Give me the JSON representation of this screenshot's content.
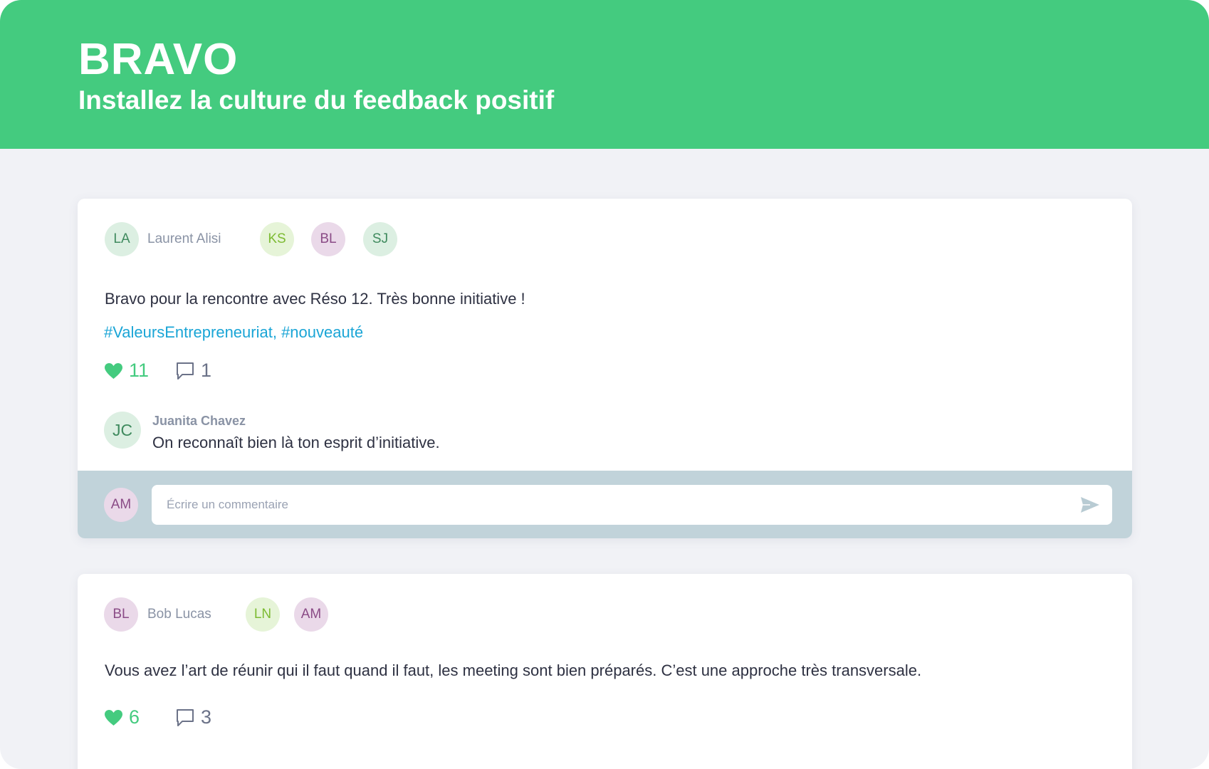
{
  "header": {
    "title": "BRAVO",
    "subtitle": "Installez la culture du feedback positif",
    "color": "#44cb7f"
  },
  "posts": [
    {
      "author": {
        "initials": "LA",
        "name": "Laurent Alisi"
      },
      "recipients": [
        {
          "initials": "KS"
        },
        {
          "initials": "BL"
        },
        {
          "initials": "SJ"
        }
      ],
      "message": "Bravo pour la rencontre avec Réso 12. Très bonne initiative !",
      "hashtags": "#ValeursEntrepreneuriat, #nouveauté",
      "likes": "11",
      "comments_count": "1",
      "comments": [
        {
          "initials": "JC",
          "author": "Juanita Chavez",
          "text": "On reconnaît bien là ton esprit d’initiative."
        }
      ],
      "composer": {
        "initials": "AM",
        "placeholder": "Écrire un commentaire",
        "send_icon": "send-icon"
      }
    },
    {
      "author": {
        "initials": "BL",
        "name": "Bob Lucas"
      },
      "recipients": [
        {
          "initials": "LN"
        },
        {
          "initials": "AM"
        }
      ],
      "message": "Vous avez l’art de réunir qui il faut quand il faut, les meeting sont bien préparés. C’est une approche très transversale.",
      "likes": "6",
      "comments_count": "3"
    }
  ],
  "icons": {
    "like": "heart-icon",
    "comment": "comment-bubble-icon",
    "arrow": "chevron-right-icon"
  }
}
